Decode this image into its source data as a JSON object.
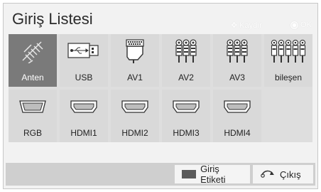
{
  "header": {
    "title": "Giriş Listesi",
    "scroll_hint": "Kaydır",
    "ok_hint": "OK"
  },
  "inputs": [
    {
      "label": "Anten",
      "icon": "antenna-icon",
      "selected": true
    },
    {
      "label": "USB",
      "icon": "usb-icon",
      "selected": false
    },
    {
      "label": "AV1",
      "icon": "scart-icon",
      "selected": false
    },
    {
      "label": "AV2",
      "icon": "rca-av-icon",
      "selected": false
    },
    {
      "label": "AV3",
      "icon": "rca-av-icon",
      "selected": false
    },
    {
      "label": "bileşen",
      "icon": "component-icon",
      "selected": false
    },
    {
      "label": "RGB",
      "icon": "vga-icon",
      "selected": false
    },
    {
      "label": "HDMI1",
      "icon": "hdmi-icon",
      "selected": false
    },
    {
      "label": "HDMI2",
      "icon": "hdmi-icon",
      "selected": false
    },
    {
      "label": "HDMI3",
      "icon": "hdmi-icon",
      "selected": false
    },
    {
      "label": "HDMI4",
      "icon": "hdmi-icon",
      "selected": false
    }
  ],
  "footer": {
    "input_label_button": "Giriş Etiketi",
    "exit_button": "Çıkış"
  },
  "colors": {
    "selected_tile": "#7a7a7a",
    "tile": "#d9d9d9",
    "panel": "#f2f2f2"
  }
}
